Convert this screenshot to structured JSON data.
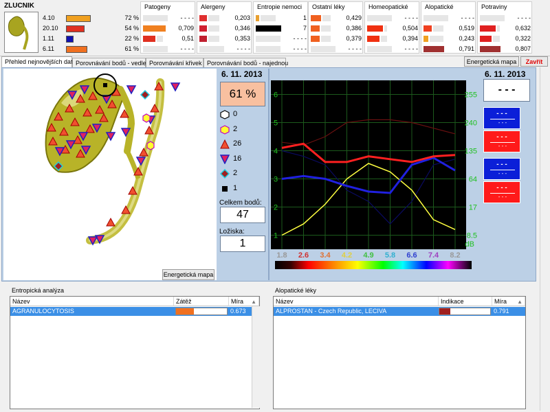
{
  "organ": {
    "name": "ZLUCNIK"
  },
  "summary": [
    {
      "value": "4.10",
      "percent": "72 %",
      "color": "#f0a020",
      "fraction": 0.72
    },
    {
      "value": "20.10",
      "percent": "54 %",
      "color": "#e03020",
      "fraction": 0.54
    },
    {
      "value": "1.11",
      "percent": "22 %",
      "color": "#1010b0",
      "fraction": 0.22
    },
    {
      "value": "6.11",
      "percent": "61 %",
      "color": "#f07020",
      "fraction": 0.61
    }
  ],
  "panels": [
    {
      "title": "Patogeny",
      "rows": [
        {
          "color": "#e8e8e8",
          "value": "- - - -",
          "fraction": 0.6
        },
        {
          "color": "#f08020",
          "value": "0,709",
          "fraction": 0.55
        },
        {
          "color": "#e03020",
          "value": "0,51",
          "fraction": 0.3
        },
        {
          "color": "#e8e8e8",
          "value": "- - - -",
          "fraction": 0.6
        }
      ]
    },
    {
      "title": "Alergeny",
      "rows": [
        {
          "color": "#e03030",
          "value": "0,203",
          "fraction": 0.18
        },
        {
          "color": "#d02030",
          "value": "0,346",
          "fraction": 0.18
        },
        {
          "color": "#c02030",
          "value": "0,353",
          "fraction": 0.18
        },
        {
          "color": "#e8e8e8",
          "value": "- - - -",
          "fraction": 0.6
        }
      ]
    },
    {
      "title": "Entropie nemoci",
      "rows": [
        {
          "color": "#e8a030",
          "value": "1",
          "fraction": 0.08
        },
        {
          "color": "#000000",
          "value": "7",
          "fraction": 0.62
        },
        {
          "color": "#e8e8e8",
          "value": "- - - -",
          "fraction": 0.6
        },
        {
          "color": "#e8e8e8",
          "value": "- - - -",
          "fraction": 0.6
        }
      ]
    },
    {
      "title": "Ostatní léky",
      "rows": [
        {
          "color": "#f06020",
          "value": "0,429",
          "fraction": 0.25
        },
        {
          "color": "#f06020",
          "value": "0,386",
          "fraction": 0.22
        },
        {
          "color": "#f06020",
          "value": "0,379",
          "fraction": 0.22
        },
        {
          "color": "#e8e8e8",
          "value": "- - - -",
          "fraction": 0.6
        }
      ]
    },
    {
      "title": "Homeopatické",
      "rows": [
        {
          "color": "#e8e8e8",
          "value": "- - - -",
          "fraction": 0.6
        },
        {
          "color": "#f03010",
          "value": "0,504",
          "fraction": 0.38
        },
        {
          "color": "#f03010",
          "value": "0,394",
          "fraction": 0.3
        },
        {
          "color": "#e8e8e8",
          "value": "- - - -",
          "fraction": 0.6
        }
      ]
    },
    {
      "title": "Alopatické",
      "rows": [
        {
          "color": "#e8e8e8",
          "value": "- - - -",
          "fraction": 0.6
        },
        {
          "color": "#f04020",
          "value": "0,519",
          "fraction": 0.2
        },
        {
          "color": "#f0a020",
          "value": "0,243",
          "fraction": 0.12
        },
        {
          "color": "#a03030",
          "value": "0,791",
          "fraction": 0.5
        }
      ]
    },
    {
      "title": "Potraviny",
      "rows": [
        {
          "color": "#e8e8e8",
          "value": "- - - -",
          "fraction": 0.6
        },
        {
          "color": "#e02020",
          "value": "0,632",
          "fraction": 0.38
        },
        {
          "color": "#e02020",
          "value": "0,322",
          "fraction": 0.28
        },
        {
          "color": "#a03030",
          "value": "0,807",
          "fraction": 0.5
        }
      ]
    }
  ],
  "tabs": [
    "Přehled nejnovějších dat",
    "Porovnávání bodů - vedle",
    "Porovnávání křivek",
    "Porovnávání bodů - najednou"
  ],
  "buttons": {
    "energy_map": "Energetická mapa",
    "close": "Zavřít",
    "energy_map_small": "Energetická mapa"
  },
  "date": "6. 11. 2013",
  "percent_box": "61 %",
  "point_counts": [
    {
      "shape": "hexagon-white",
      "count": "0"
    },
    {
      "shape": "hexagon-yellow",
      "count": "2"
    },
    {
      "shape": "triangle-up-red",
      "count": "26"
    },
    {
      "shape": "triangle-down-blue",
      "count": "16"
    },
    {
      "shape": "diamond-cyan",
      "count": "2"
    },
    {
      "shape": "square-black",
      "count": "1"
    }
  ],
  "total_points_label": "Celkem bodů:",
  "total_points": "47",
  "foci_label": "Ložiska:",
  "foci": "1",
  "right_info": {
    "date": "6. 11. 2013",
    "dash": "- - -",
    "cells": [
      {
        "color": "blue",
        "top": "- - -",
        "bottom": "- - -"
      },
      {
        "color": "red",
        "top": "- - -",
        "bottom": "- - -"
      },
      {
        "color": "blue",
        "top": "- - -",
        "bottom": "- - -"
      },
      {
        "color": "red",
        "top": "- - -",
        "bottom": "- - -"
      }
    ]
  },
  "chart_data": {
    "type": "line",
    "left_ticks": [
      "1",
      "2",
      "3",
      "4",
      "5",
      "6"
    ],
    "right_ticks": [
      "8.5",
      "17",
      "64",
      "135",
      "240",
      "255"
    ],
    "right_unit": "dB",
    "x_ticks": [
      {
        "label": "1.8",
        "color": "#999999"
      },
      {
        "label": "2.6",
        "color": "#d03030"
      },
      {
        "label": "3.4",
        "color": "#e07030"
      },
      {
        "label": "4.2",
        "color": "#e0d040"
      },
      {
        "label": "4.9",
        "color": "#40c040"
      },
      {
        "label": "5.8",
        "color": "#30b0d0"
      },
      {
        "label": "6.6",
        "color": "#3040d0"
      },
      {
        "label": "7.4",
        "color": "#a040c0"
      },
      {
        "label": "8.2",
        "color": "#999999"
      }
    ],
    "ylim": [
      0.5,
      6.5
    ],
    "series": [
      {
        "color": "#ff2020",
        "width": 3,
        "y": [
          4.1,
          4.25,
          3.6,
          3.6,
          3.8,
          3.7,
          3.6,
          3.8,
          3.85
        ]
      },
      {
        "color": "#2020e0",
        "width": 3,
        "y": [
          3.0,
          3.1,
          3.0,
          2.75,
          2.55,
          2.5,
          3.5,
          3.75,
          3.3
        ]
      },
      {
        "color": "#ffff40",
        "width": 1.5,
        "y": [
          1.0,
          1.4,
          2.1,
          3.0,
          3.55,
          3.25,
          2.6,
          1.55,
          1.2
        ]
      },
      {
        "color": "#6a1010",
        "width": 1.2,
        "y": [
          4.3,
          4.2,
          4.5,
          5.0,
          5.1,
          5.1,
          5.0,
          4.8,
          4.6
        ]
      },
      {
        "color": "#0a0a60",
        "width": 1.2,
        "y": [
          4.0,
          3.8,
          3.5,
          2.6,
          2.2,
          1.4,
          2.2,
          3.5,
          3.7
        ]
      }
    ]
  },
  "entropic": {
    "title": "Entropická analýza",
    "headers": [
      "Název",
      "Zátěž",
      "Míra"
    ],
    "rows": [
      {
        "name": "AGRANULOCYTOSIS",
        "value": "0.673",
        "bar_color": "#f07020",
        "fraction": 0.35
      }
    ]
  },
  "alopathic": {
    "title": "Alopatické léky",
    "headers": [
      "Název",
      "Indikace",
      "Míra"
    ],
    "rows": [
      {
        "name": "ALPROSTAN - Czech Republic, LECIVA",
        "value": "0.791",
        "bar_color": "#a02020",
        "fraction": 0.22
      }
    ]
  }
}
